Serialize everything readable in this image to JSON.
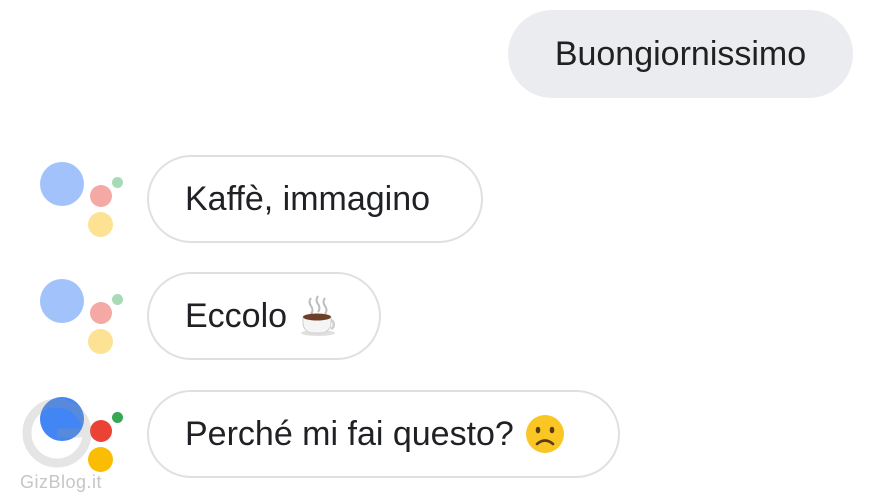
{
  "conversation": {
    "user_message": "Buongiornissimo",
    "assistant_messages": [
      {
        "text": "Kaffè, immagino",
        "emoji": null
      },
      {
        "text": "Eccolo",
        "emoji": "coffee-cup-icon"
      },
      {
        "text": "Perché mi fai questo?",
        "emoji": "sad-face-icon"
      }
    ]
  },
  "watermark": {
    "text": "GizBlog.it"
  },
  "colors": {
    "user_bubble_bg": "#ebecef",
    "assistant_border": "#e0e0e0",
    "text": "#202124",
    "faded_blue": "#a1c2fa",
    "faded_red": "#f4a9a5",
    "faded_yellow": "#fde293",
    "faded_green": "#a8dab5",
    "blue": "#4285f4",
    "red": "#ea4335",
    "yellow": "#fbbc04",
    "green": "#34a853"
  }
}
